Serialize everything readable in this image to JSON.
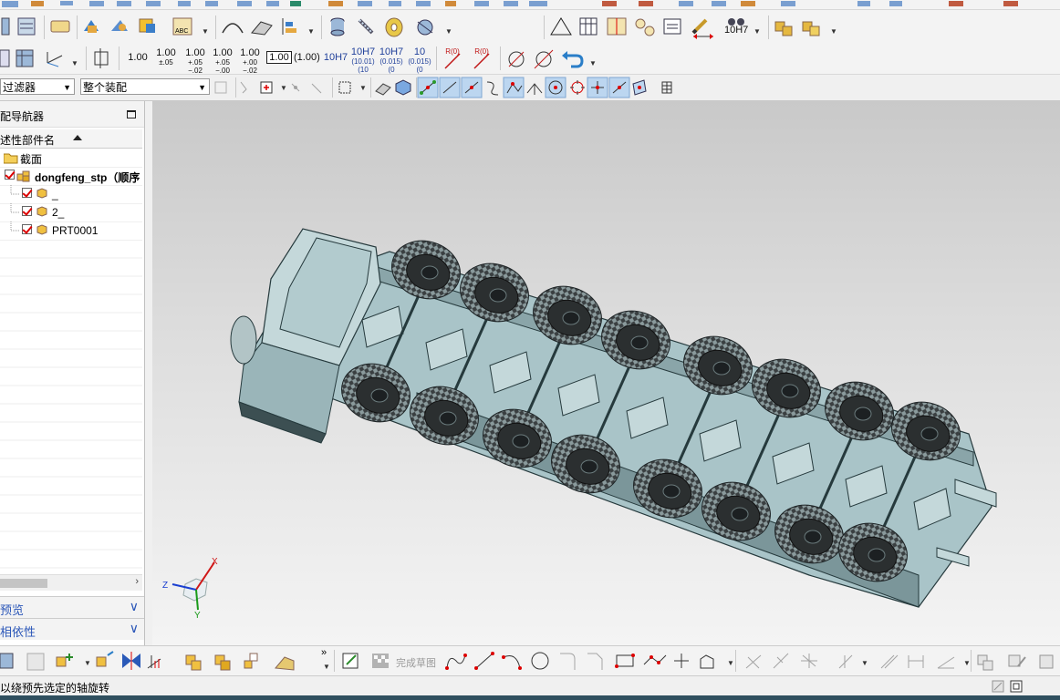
{
  "toolbar": {
    "dimension_buttons": [
      {
        "main": "1.00",
        "sub": ""
      },
      {
        "main": "1.00",
        "sub": "±.05"
      },
      {
        "main": "1.00",
        "sub": "+.05 −.02"
      },
      {
        "main": "1.00",
        "sub": "+.05 −.00"
      },
      {
        "main": "1.00",
        "sub": "+.00 −.02"
      },
      {
        "main": "1.00",
        "sub": ""
      },
      {
        "main": "(1.00)",
        "sub": ""
      },
      {
        "main": "10H7",
        "sub": ""
      },
      {
        "main": "10H7",
        "sub": "(10.01) (10"
      },
      {
        "main": "10H7",
        "sub": "(0.015) (0"
      },
      {
        "main": "10",
        "sub": "(0.015) (0"
      }
    ],
    "fit_label": "10H7",
    "rot_label_1": "R(0)",
    "rot_label_2": "R(0)",
    "filter_combo": "过滤器",
    "assembly_combo": "整个装配",
    "finish_sketch_label": "完成草图"
  },
  "navigator": {
    "title": "配导航器",
    "column_header": "述性部件名",
    "rows": [
      {
        "label": "截面",
        "type": "folder",
        "indent": 0
      },
      {
        "label": "dongfeng_stp（顺序",
        "type": "assembly",
        "indent": 0,
        "bold": true
      },
      {
        "label": "_",
        "type": "part",
        "indent": 1
      },
      {
        "label": "2_",
        "type": "part",
        "indent": 1
      },
      {
        "label": "PRT0001",
        "type": "part",
        "indent": 1
      }
    ],
    "panel_preview": "预览",
    "panel_dependency": "相依性"
  },
  "triad": {
    "x_label": "X",
    "y_label": "Y",
    "z_label": "Z"
  },
  "status": {
    "message": "以绕预先选定的轴旋转"
  },
  "colors": {
    "model_fill": "#a9c4c8",
    "model_edge": "#263a3d",
    "tire": "#2b2f30",
    "accent_red": "#d01818"
  }
}
